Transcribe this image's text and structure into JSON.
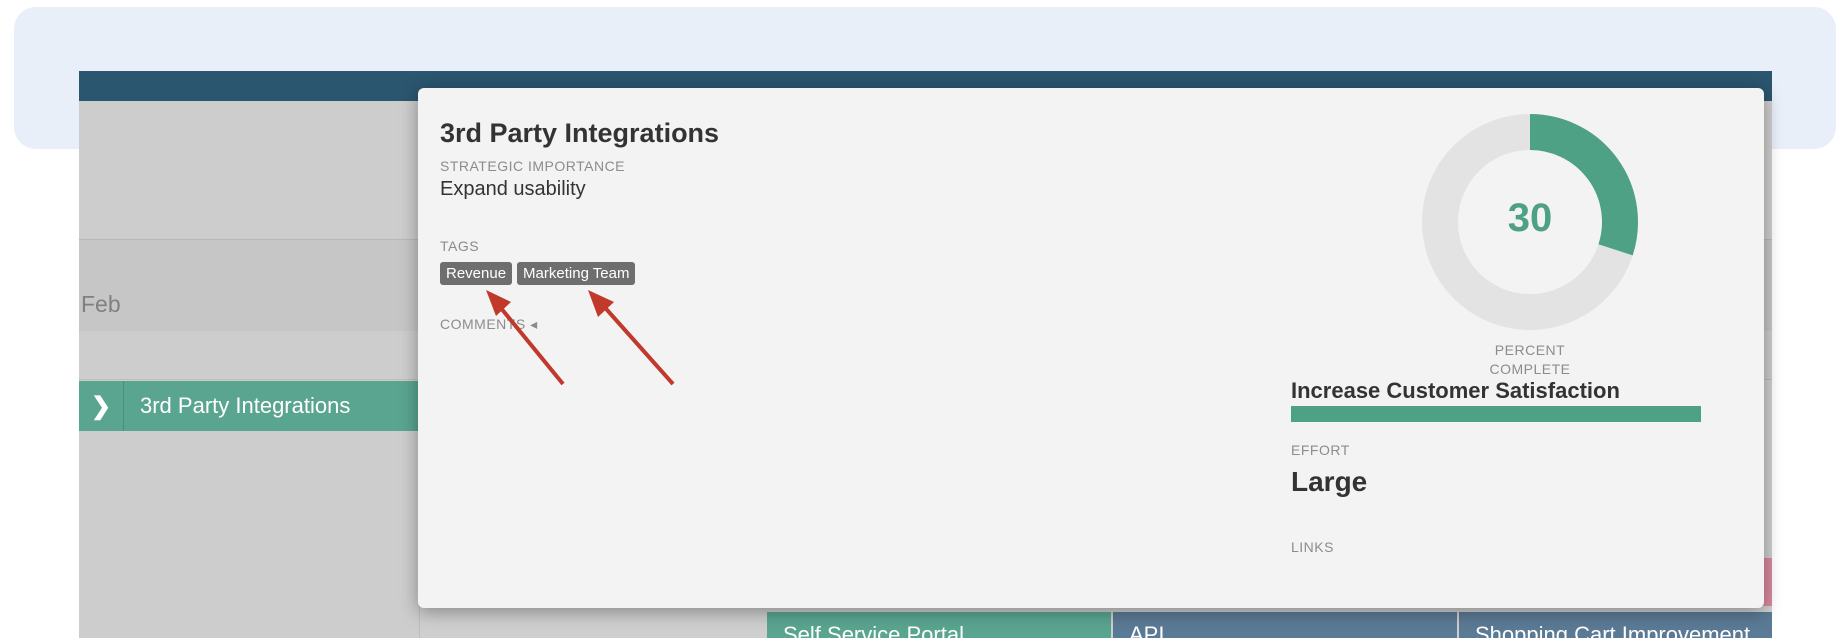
{
  "colors": {
    "accent": "#4fa186",
    "topbar": "#2b566f",
    "tag_bg": "#6e6e6e",
    "arrow": "#c0392b"
  },
  "background": {
    "timeline_month": "Feb",
    "feature_row_label": "3rd Party Integrations",
    "bottom_cards": [
      "Self Service Portal",
      "API",
      "Shopping Cart Improvement"
    ]
  },
  "popup": {
    "title": "3rd Party Integrations",
    "strategic_importance_label": "STRATEGIC IMPORTANCE",
    "strategic_importance_value": "Expand usability",
    "tags_label": "TAGS",
    "tags": [
      "Revenue",
      "Marketing Team"
    ],
    "comments_label": "COMMENTS",
    "comments_indicator": "◂",
    "percent_complete": 30,
    "percent_complete_label_line1": "PERCENT",
    "percent_complete_label_line2": "COMPLETE",
    "goal_title": "Increase Customer Satisfaction",
    "goal_progress": 1.0,
    "effort_label": "EFFORT",
    "effort_value": "Large",
    "links_label": "LINKS"
  },
  "icons": {
    "expand_chevron": "chevron-right-icon",
    "annotation_arrows": "red-arrow-icon"
  }
}
